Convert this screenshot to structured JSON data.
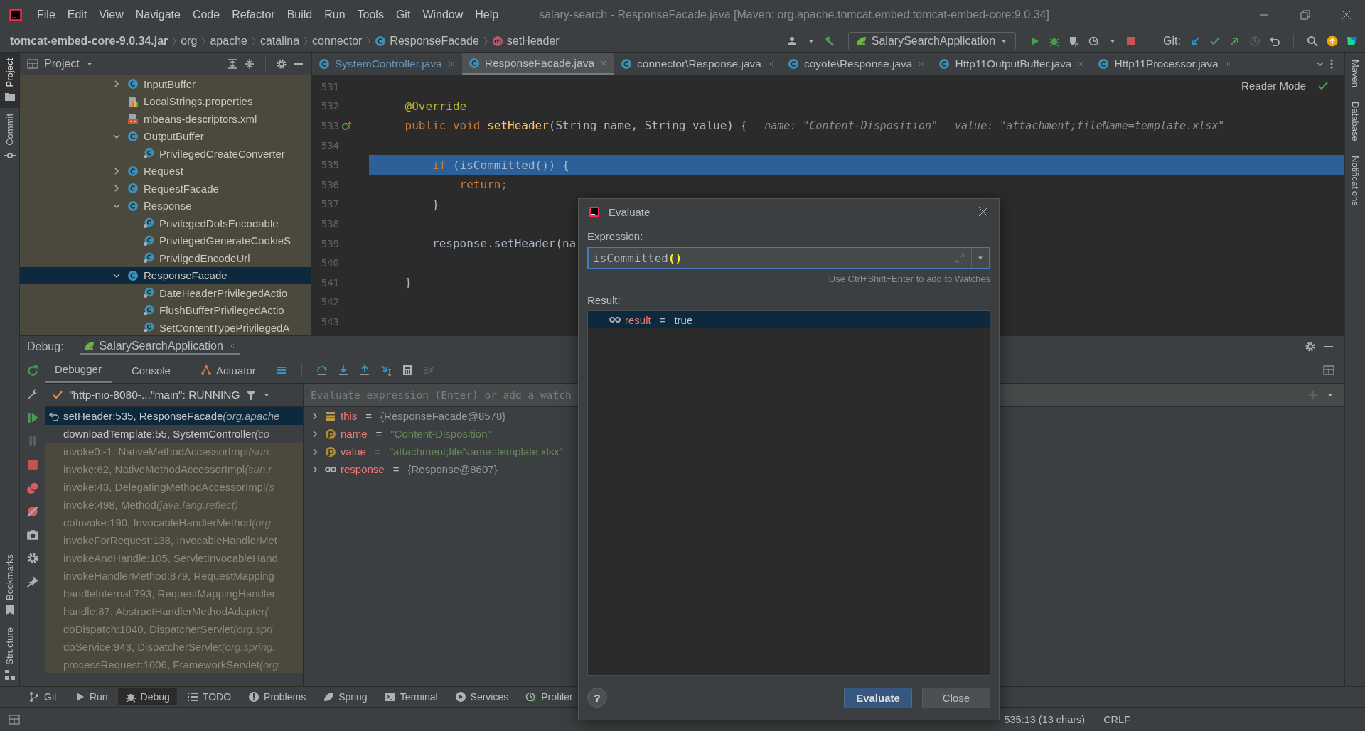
{
  "menu_bar": {
    "items": [
      "File",
      "Edit",
      "View",
      "Navigate",
      "Code",
      "Refactor",
      "Build",
      "Run",
      "Tools",
      "Git",
      "Window",
      "Help"
    ],
    "window_title": "salary-search - ResponseFacade.java [Maven: org.apache.tomcat.embed:tomcat-embed-core:9.0.34]"
  },
  "breadcrumbs": [
    {
      "label": "tomcat-embed-core-9.0.34.jar",
      "kind": "jar"
    },
    {
      "label": "org",
      "kind": "package"
    },
    {
      "label": "apache",
      "kind": "package"
    },
    {
      "label": "catalina",
      "kind": "package"
    },
    {
      "label": "connector",
      "kind": "package"
    },
    {
      "label": "ResponseFacade",
      "kind": "class"
    },
    {
      "label": "setHeader",
      "kind": "method"
    }
  ],
  "toolbar": {
    "run_config": "SalarySearchApplication",
    "vcs_label": "Git:"
  },
  "left_strip": {
    "top": [
      {
        "label": "Project",
        "selected": true
      },
      {
        "label": "Commit",
        "selected": false
      }
    ],
    "bottom": [
      "Bookmarks",
      "Structure"
    ]
  },
  "right_strip": [
    "Maven",
    "Database",
    "Notifications"
  ],
  "project_panel": {
    "title": "Project",
    "tree": [
      {
        "label": "InputBuffer",
        "kind": "class",
        "expanded": false,
        "selected": false
      },
      {
        "label": "LocalStrings.properties",
        "kind": "properties",
        "selected": false
      },
      {
        "label": "mbeans-descriptors.xml",
        "kind": "xml",
        "selected": false
      },
      {
        "label": "OutputBuffer",
        "kind": "class",
        "expanded": true,
        "selected": false,
        "children": [
          {
            "label": "PrivilegedCreateConverter",
            "kind": "inner",
            "selected": false
          }
        ]
      },
      {
        "label": "Request",
        "kind": "class",
        "expanded": false,
        "selected": false
      },
      {
        "label": "RequestFacade",
        "kind": "class",
        "expanded": false,
        "selected": false
      },
      {
        "label": "Response",
        "kind": "class",
        "expanded": true,
        "selected": false,
        "children": [
          {
            "label": "PrivilegedDoIsEncodable",
            "kind": "inner",
            "selected": false
          },
          {
            "label": "PrivilegedGenerateCookieS",
            "kind": "inner",
            "selected": false
          },
          {
            "label": "PrivilgedEncodeUrl",
            "kind": "inner",
            "selected": false
          }
        ]
      },
      {
        "label": "ResponseFacade",
        "kind": "class",
        "expanded": true,
        "selected": true,
        "children": [
          {
            "label": "DateHeaderPrivilegedActio",
            "kind": "inner",
            "selected": false
          },
          {
            "label": "FlushBufferPrivilegedActio",
            "kind": "inner",
            "selected": false
          },
          {
            "label": "SetContentTypePrivilegedA",
            "kind": "inner",
            "selected": false
          }
        ]
      }
    ]
  },
  "editor": {
    "tabs": [
      {
        "label": "SystemController.java",
        "selected": false,
        "modified": true
      },
      {
        "label": "ResponseFacade.java",
        "selected": true,
        "modified": false
      },
      {
        "label": "connector\\Response.java",
        "selected": false,
        "modified": false
      },
      {
        "label": "coyote\\Response.java",
        "selected": false,
        "modified": false
      },
      {
        "label": "Http11OutputBuffer.java",
        "selected": false,
        "modified": false
      },
      {
        "label": "Http11Processor.java",
        "selected": false,
        "modified": false
      }
    ],
    "reader_mode": "Reader Mode",
    "lines": [
      {
        "number": "531",
        "highlighted": false,
        "override": false
      },
      {
        "number": "532",
        "highlighted": false,
        "override": false,
        "tokens": [
          {
            "text": "    @Override",
            "kind": "annotation"
          }
        ]
      },
      {
        "number": "533",
        "highlighted": false,
        "override": true,
        "tokens": [
          {
            "text": "    public void ",
            "kind": "keyword"
          },
          {
            "text": "setHeader",
            "kind": "method"
          },
          {
            "text": "(String name, String value) {",
            "kind": "plain"
          },
          {
            "text": "name: \"Content-Disposition\"",
            "kind": "hint"
          },
          {
            "text": "value: \"attachment;fileName=template.xlsx\"",
            "kind": "hint"
          }
        ]
      },
      {
        "number": "534",
        "highlighted": false,
        "override": false
      },
      {
        "number": "535",
        "highlighted": true,
        "override": false,
        "tokens": [
          {
            "text": "        if ",
            "kind": "keyword"
          },
          {
            "text": "(isCommitted()) {",
            "kind": "plain"
          }
        ]
      },
      {
        "number": "536",
        "highlighted": false,
        "override": false,
        "tokens": [
          {
            "text": "            return;",
            "kind": "keyword"
          }
        ]
      },
      {
        "number": "537",
        "highlighted": false,
        "override": false,
        "tokens": [
          {
            "text": "        }",
            "kind": "plain"
          }
        ]
      },
      {
        "number": "538",
        "highlighted": false,
        "override": false
      },
      {
        "number": "539",
        "highlighted": false,
        "override": false,
        "tokens": [
          {
            "text": "        response.setHeader(na",
            "kind": "plain"
          }
        ]
      },
      {
        "number": "540",
        "highlighted": false,
        "override": false
      },
      {
        "number": "541",
        "highlighted": false,
        "override": false,
        "tokens": [
          {
            "text": "    }",
            "kind": "plain"
          }
        ]
      },
      {
        "number": "542",
        "highlighted": false,
        "override": false
      },
      {
        "number": "543",
        "highlighted": false,
        "override": false
      }
    ]
  },
  "debug": {
    "label": "Debug:",
    "session": "SalarySearchApplication",
    "tabs": [
      {
        "label": "Debugger",
        "selected": true
      },
      {
        "label": "Console",
        "selected": false
      },
      {
        "label": "Actuator",
        "selected": false
      }
    ],
    "thread": "\"http-nio-8080-...\"main\": RUNNING",
    "frames": [
      {
        "method": "setHeader:535, ResponseFacade",
        "package": "(org.apache",
        "selected": true,
        "library": false
      },
      {
        "method": "downloadTemplate:55, SystemController",
        "package": "(co",
        "selected": false,
        "library": false
      },
      {
        "method": "invoke0:-1, NativeMethodAccessorImpl",
        "package": "(sun.",
        "selected": false,
        "library": true
      },
      {
        "method": "invoke:62, NativeMethodAccessorImpl",
        "package": "(sun.r",
        "selected": false,
        "library": true
      },
      {
        "method": "invoke:43, DelegatingMethodAccessorImpl",
        "package": "(s",
        "selected": false,
        "library": true
      },
      {
        "method": "invoke:498, Method",
        "package": "(java.lang.reflect)",
        "selected": false,
        "library": true
      },
      {
        "method": "doInvoke:190, InvocableHandlerMethod",
        "package": "(org",
        "selected": false,
        "library": true
      },
      {
        "method": "invokeForRequest:138, InvocableHandlerMet",
        "selected": false,
        "library": true
      },
      {
        "method": "invokeAndHandle:105, ServletInvocableHand",
        "selected": false,
        "library": true
      },
      {
        "method": "invokeHandlerMethod:879, RequestMapping",
        "selected": false,
        "library": true
      },
      {
        "method": "handleInternal:793, RequestMappingHandler",
        "selected": false,
        "library": true
      },
      {
        "method": "handle:87, AbstractHandlerMethodAdapter",
        "package": "(",
        "selected": false,
        "library": true
      },
      {
        "method": "doDispatch:1040, DispatcherServlet",
        "package": "(org.spri",
        "selected": false,
        "library": true
      },
      {
        "method": "doService:943, DispatcherServlet",
        "package": "(org.spring.",
        "selected": false,
        "library": true
      },
      {
        "method": "processRequest:1006, FrameworkServlet",
        "package": "(org",
        "selected": false,
        "library": true
      }
    ],
    "watch_placeholder": "Evaluate expression (Enter) or add a watch",
    "variables": [
      {
        "kind": "field",
        "name": "this",
        "operator": "=",
        "value": "{ResponseFacade@8578}"
      },
      {
        "kind": "param",
        "name": "name",
        "operator": "=",
        "value": "\"Content-Disposition\""
      },
      {
        "kind": "param",
        "name": "value",
        "operator": "=",
        "value": "\"attachment;fileName=template.xlsx\""
      },
      {
        "kind": "watch",
        "name": "response",
        "operator": "=",
        "value": "{Response@8607}"
      }
    ]
  },
  "evaluate_dialog": {
    "title": "Evaluate",
    "expression_label": "Expression:",
    "expression": [
      {
        "text": "isCommitted",
        "kind": "plain"
      },
      {
        "text": "()",
        "kind": "paren"
      }
    ],
    "hint": "Use Ctrl+Shift+Enter to add to Watches",
    "result_label": "Result:",
    "results": [
      {
        "name": "result",
        "operator": "=",
        "value": "true",
        "selected": true
      }
    ],
    "help": "?",
    "buttons": [
      {
        "label": "Evaluate",
        "primary": true
      },
      {
        "label": "Close",
        "primary": false
      }
    ]
  },
  "bottom_tools": [
    {
      "label": "Git",
      "selected": false
    },
    {
      "label": "Run",
      "selected": false
    },
    {
      "label": "Debug",
      "selected": true
    },
    {
      "label": "TODO",
      "selected": false
    },
    {
      "label": "Problems",
      "selected": false
    },
    {
      "label": "Spring",
      "selected": false
    },
    {
      "label": "Terminal",
      "selected": false
    },
    {
      "label": "Services",
      "selected": false
    },
    {
      "label": "Profiler",
      "selected": false
    }
  ],
  "status_bar": {
    "position": "535:13 (13 chars)",
    "line_ending": "CRLF"
  }
}
